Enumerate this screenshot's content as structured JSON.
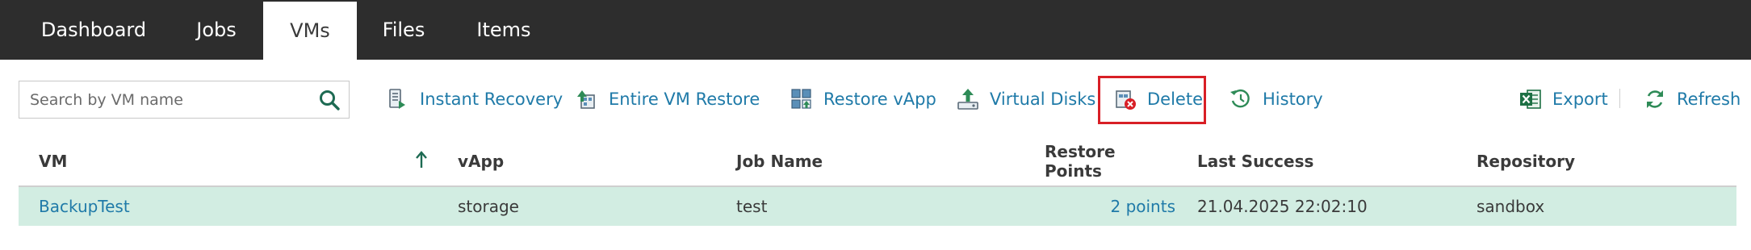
{
  "tabs": [
    {
      "label": "Dashboard"
    },
    {
      "label": "Jobs"
    },
    {
      "label": "VMs",
      "active": true
    },
    {
      "label": "Files"
    },
    {
      "label": "Items"
    }
  ],
  "search": {
    "placeholder": "Search by VM name",
    "value": "",
    "icon": "search-icon"
  },
  "toolbar": {
    "instant_recovery": {
      "label": "Instant Recovery",
      "icon": "instant-recovery-icon"
    },
    "entire_vm_restore": {
      "label": "Entire VM Restore",
      "icon": "entire-vm-restore-icon"
    },
    "restore_vapp": {
      "label": "Restore vApp",
      "icon": "restore-vapp-icon"
    },
    "virtual_disks": {
      "label": "Virtual Disks",
      "icon": "virtual-disks-icon"
    },
    "delete": {
      "label": "Delete",
      "icon": "delete-icon",
      "highlight_color": "#d81f26"
    },
    "history": {
      "label": "History",
      "icon": "history-icon"
    },
    "export": {
      "label": "Export",
      "icon": "excel-icon"
    },
    "refresh": {
      "label": "Refresh",
      "icon": "refresh-icon"
    }
  },
  "grid": {
    "columns": [
      {
        "label": "VM",
        "sorted": "ascending"
      },
      {
        "label": "vApp"
      },
      {
        "label": "Job Name"
      },
      {
        "label": "Restore Points"
      },
      {
        "label": "Last Success"
      },
      {
        "label": "Repository"
      }
    ],
    "rows": [
      {
        "vm": "BackupTest",
        "vapp": "storage",
        "job_name": "test",
        "restore_points": "2 points",
        "last_success": "21.04.2025 22:02:10",
        "repository": "sandbox",
        "selected": true
      }
    ]
  },
  "colors": {
    "tabbar_bg": "#2d2d2d",
    "link": "#1f7aa8",
    "selected_row": "#d2ede2",
    "icon_green": "#2e8b57",
    "excel_green": "#1d7044"
  }
}
